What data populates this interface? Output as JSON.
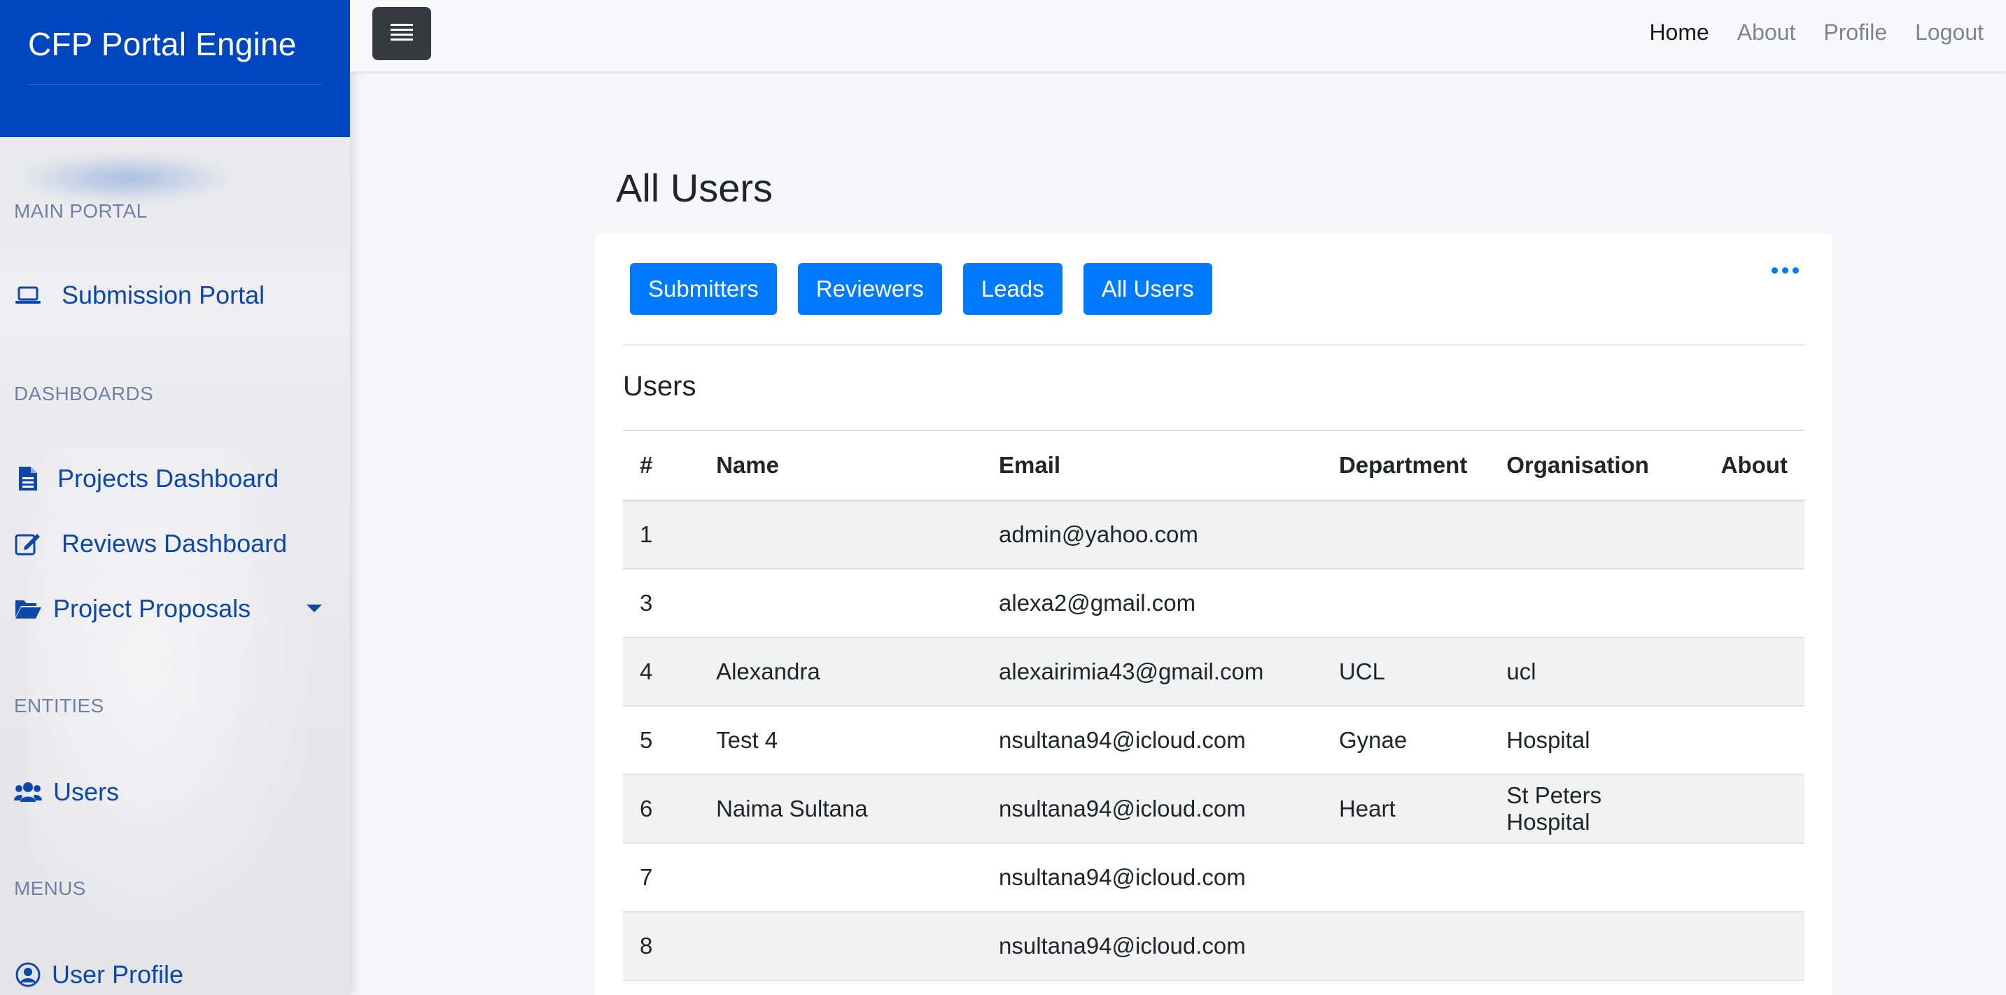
{
  "app": {
    "brand": "CFP Portal Engine"
  },
  "sidebar": {
    "sections": {
      "main_portal": "MAIN PORTAL",
      "dashboards": "DASHBOARDS",
      "entities": "ENTITIES",
      "menus": "MENUS"
    },
    "items": {
      "submission_portal": {
        "label": "Submission Portal",
        "icon": "laptop-icon"
      },
      "projects_dashboard": {
        "label": "Projects Dashboard",
        "icon": "file-icon"
      },
      "reviews_dashboard": {
        "label": "Reviews Dashboard",
        "icon": "edit-icon"
      },
      "project_proposals": {
        "label": "Project Proposals",
        "icon": "folder-open-icon"
      },
      "users": {
        "label": "Users",
        "icon": "users-icon"
      },
      "user_profile": {
        "label": "User Profile",
        "icon": "user-circle-icon"
      }
    }
  },
  "topbar": {
    "toggle_icon": "menu-icon",
    "links": {
      "home": "Home",
      "about": "About",
      "profile": "Profile",
      "logout": "Logout"
    }
  },
  "main": {
    "title": "All Users",
    "filters": {
      "submitters": "Submitters",
      "reviewers": "Reviewers",
      "leads": "Leads",
      "all_users": "All Users"
    },
    "more_icon": "ellipsis-icon",
    "section_title": "Users",
    "table": {
      "headers": {
        "num": "#",
        "name": "Name",
        "email": "Email",
        "department": "Department",
        "organisation": "Organisation",
        "about": "About"
      },
      "rows": [
        {
          "num": "1",
          "name": "",
          "email": "admin@yahoo.com",
          "department": "",
          "organisation": "",
          "about": ""
        },
        {
          "num": "3",
          "name": "",
          "email": "alexa2@gmail.com",
          "department": "",
          "organisation": "",
          "about": ""
        },
        {
          "num": "4",
          "name": "Alexandra",
          "email": "alexairimia43@gmail.com",
          "department": "UCL",
          "organisation": "ucl",
          "about": ""
        },
        {
          "num": "5",
          "name": "Test 4",
          "email": "nsultana94@icloud.com",
          "department": "Gynae",
          "organisation": "Hospital",
          "about": ""
        },
        {
          "num": "6",
          "name": "Naima Sultana",
          "email": "nsultana94@icloud.com",
          "department": "Heart",
          "organisation": "St Peters Hospital",
          "about": ""
        },
        {
          "num": "7",
          "name": "",
          "email": "nsultana94@icloud.com",
          "department": "",
          "organisation": "",
          "about": ""
        },
        {
          "num": "8",
          "name": "",
          "email": "nsultana94@icloud.com",
          "department": "",
          "organisation": "",
          "about": ""
        }
      ]
    }
  },
  "colors": {
    "brand_bg": "#0046be",
    "primary": "#007bff",
    "nav_text": "#0d47a8",
    "toggle_bg": "#343a40"
  }
}
